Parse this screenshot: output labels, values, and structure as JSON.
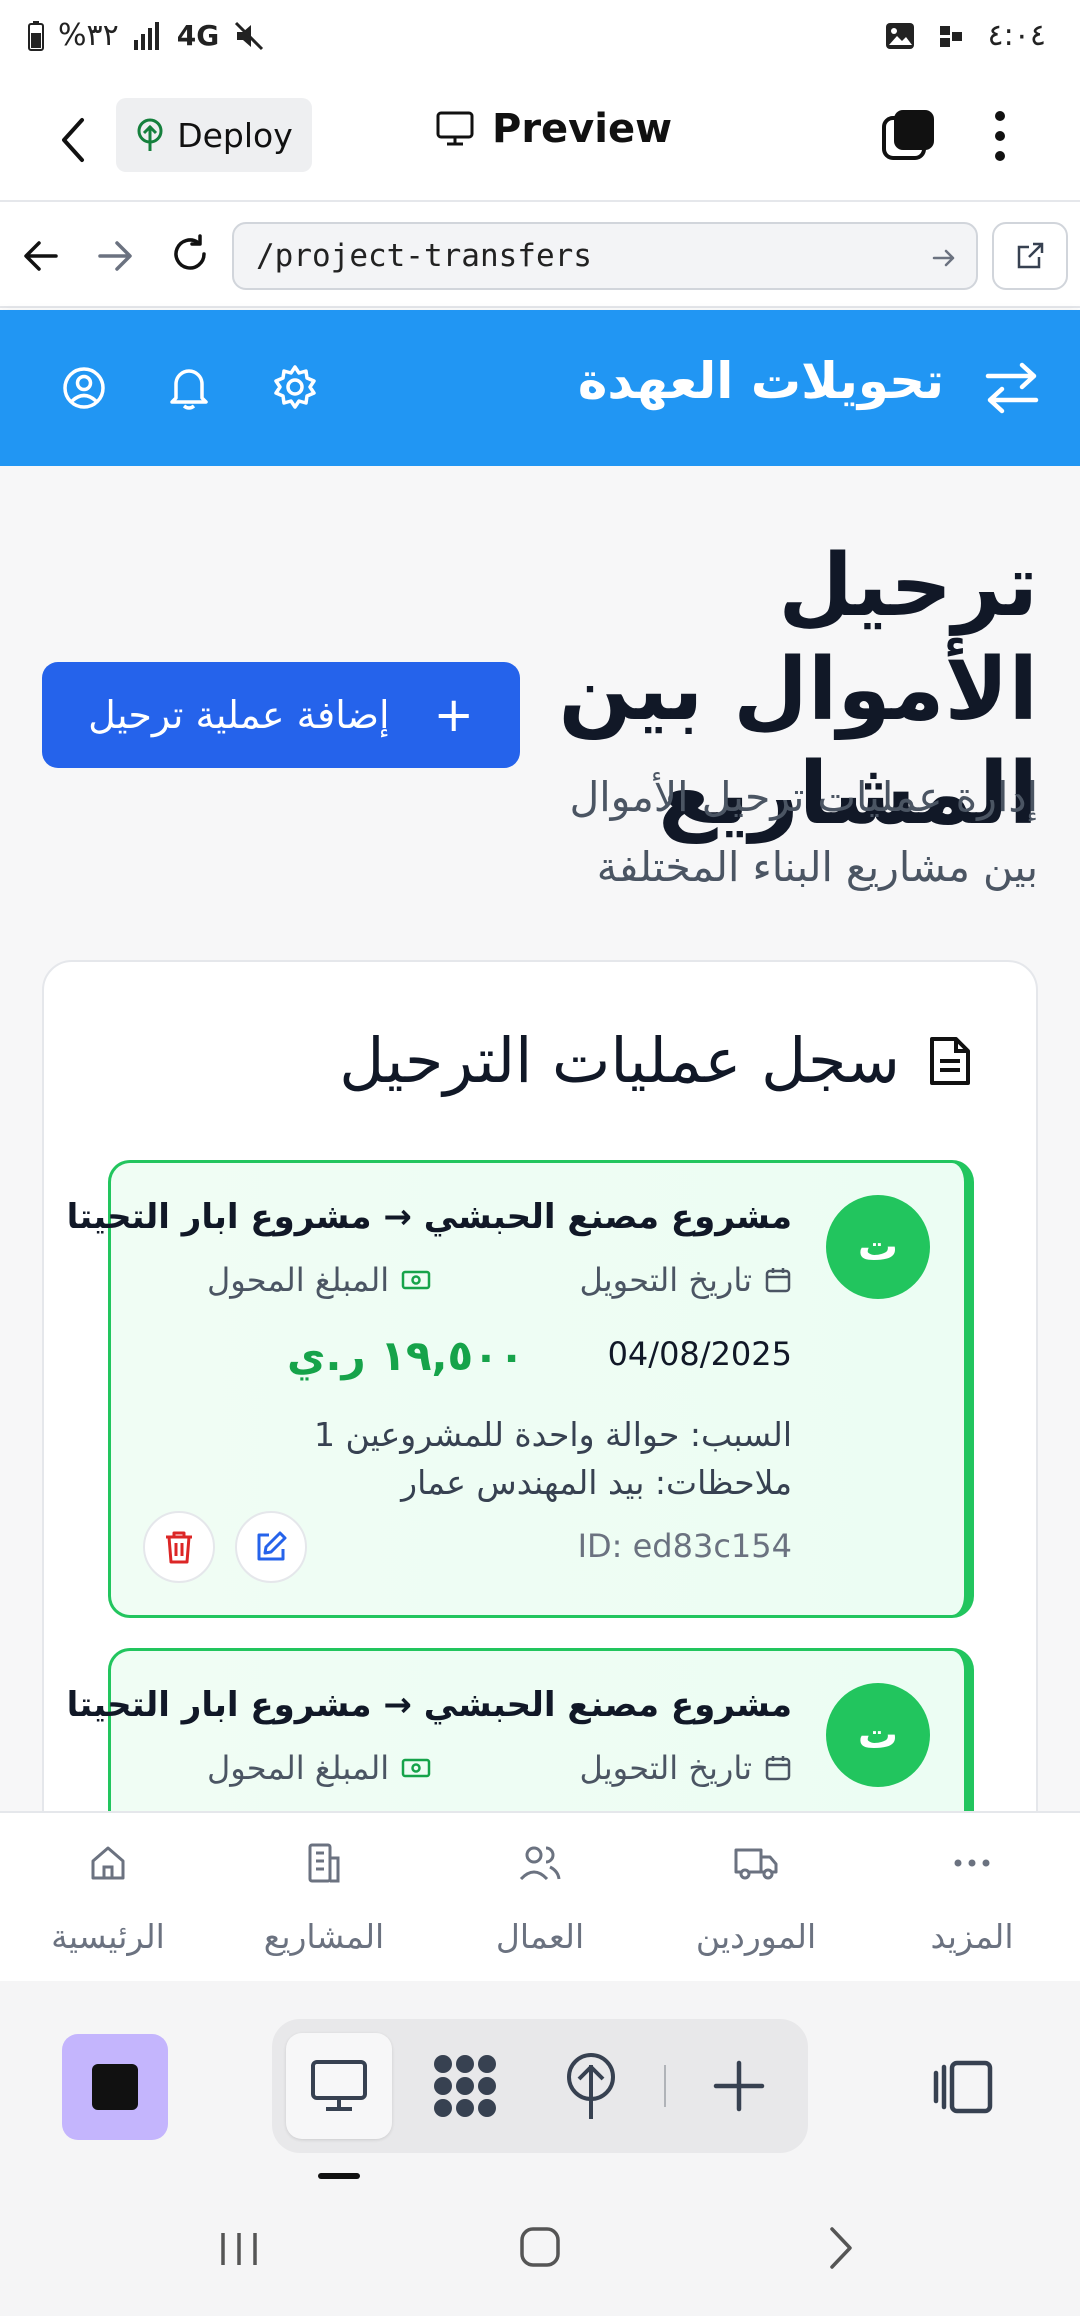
{
  "status_bar": {
    "battery": "%٣٢",
    "network": "4G",
    "time": "٤:٠٤"
  },
  "app_bar": {
    "deploy_label": "Deploy",
    "preview_label": "Preview"
  },
  "url_bar": {
    "url": "/project-transfers"
  },
  "header": {
    "title": "تحويلات العهدة"
  },
  "page": {
    "title": "ترحيل الأموال بين المشاريع",
    "subtitle": "إدارة عمليات ترحيل الأموال بين مشاريع البناء المختلفة",
    "add_button": "إضافة عملية ترحيل"
  },
  "log_card": {
    "title": "سجل عمليات الترحيل",
    "transfers": [
      {
        "avatar": "ت",
        "route": "مشروع مصنع الحبشي → مشروع ابار التحيتا",
        "date_label": "تاريخ التحويل",
        "amount_label": "المبلغ المحول",
        "date": "04/08/2025",
        "amount": "١٩,٥٠٠ ر.ي",
        "reason": "السبب: حوالة واحدة للمشروعين 1",
        "notes": "ملاحظات: بيد المهندس عمار",
        "id": "ID: ed83c154"
      },
      {
        "avatar": "ت",
        "route": "مشروع مصنع الحبشي → مشروع ابار التحيتا",
        "date_label": "تاريخ التحويل",
        "amount_label": "المبلغ المحول"
      }
    ]
  },
  "bottom_nav": {
    "items": [
      {
        "label": "الرئيسية",
        "icon": "home-icon"
      },
      {
        "label": "المشاريع",
        "icon": "building-icon"
      },
      {
        "label": "العمال",
        "icon": "users-icon"
      },
      {
        "label": "الموردين",
        "icon": "truck-icon"
      },
      {
        "label": "المزيد",
        "icon": "more-icon"
      }
    ]
  },
  "colors": {
    "header_blue": "#2196f3",
    "primary_button": "#2563eb",
    "success_green": "#22c55e",
    "purple_accent": "#c4b5fd"
  }
}
